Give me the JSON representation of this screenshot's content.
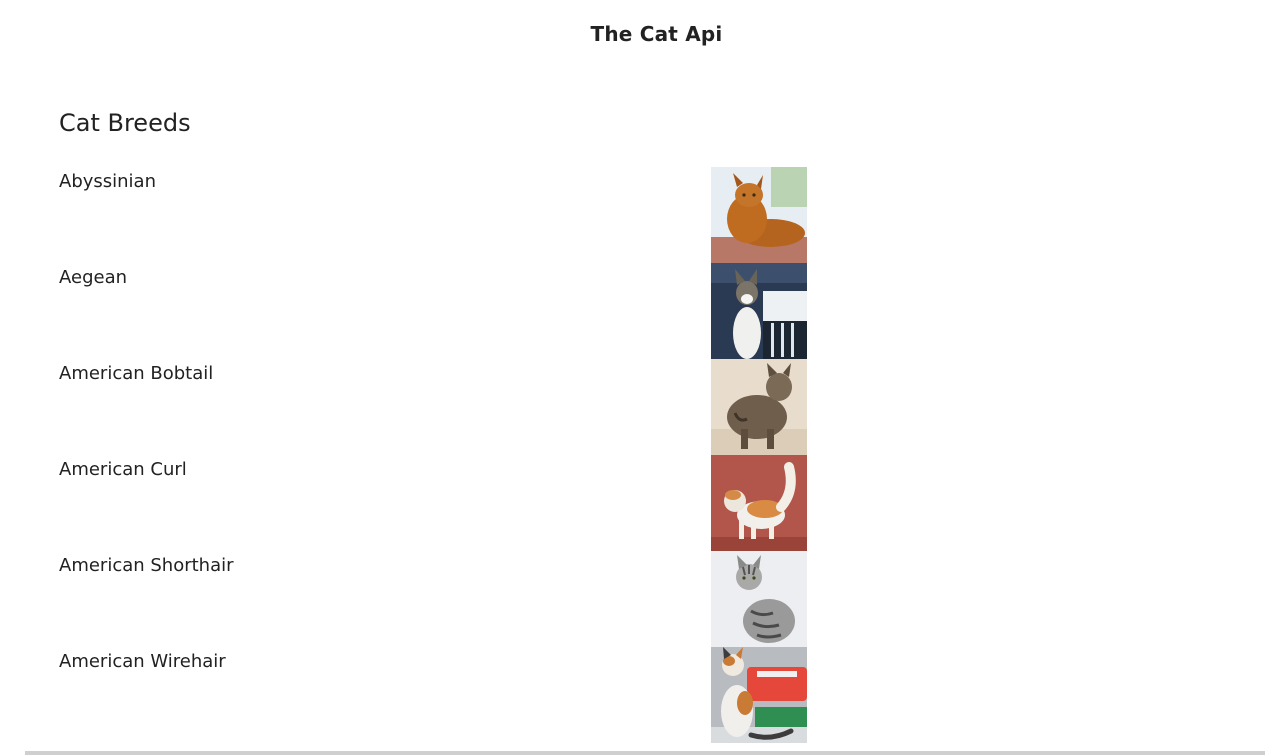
{
  "app": {
    "title": "The Cat Api"
  },
  "main": {
    "section_title": "Cat Breeds",
    "breeds": [
      {
        "name": "Abyssinian"
      },
      {
        "name": "Aegean"
      },
      {
        "name": "American Bobtail"
      },
      {
        "name": "American Curl"
      },
      {
        "name": "American Shorthair"
      },
      {
        "name": "American Wirehair"
      }
    ]
  }
}
